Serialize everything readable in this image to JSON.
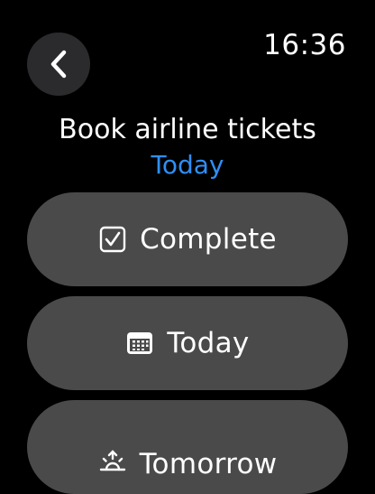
{
  "status_bar": {
    "time": "16:36"
  },
  "header": {
    "back_icon": "chevron-left-icon",
    "title": "Book airline tickets",
    "subtitle": "Today"
  },
  "actions": [
    {
      "label": "Complete",
      "icon": "checkbox-icon"
    },
    {
      "label": "Today",
      "icon": "calendar-icon"
    },
    {
      "label": "Tomorrow",
      "icon": "sunrise-icon"
    }
  ],
  "colors": {
    "background": "#000000",
    "accent": "#2f8ff5",
    "button_background": "#4a4a4a",
    "back_button_background": "#2b2b2d",
    "text": "#ffffff"
  }
}
